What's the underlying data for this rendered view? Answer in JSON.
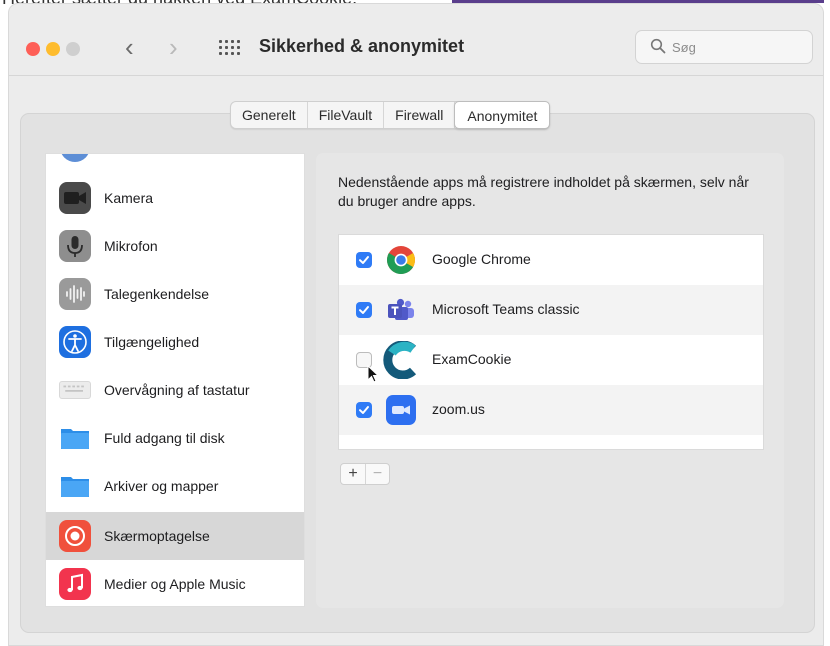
{
  "caption": "Herefter sætter du hakken ved ExamCookie.",
  "window": {
    "title": "Sikkerhed & anonymitet",
    "search_placeholder": "Søg"
  },
  "tabs": [
    {
      "label": "Generelt",
      "active": false
    },
    {
      "label": "FileVault",
      "active": false
    },
    {
      "label": "Firewall",
      "active": false
    },
    {
      "label": "Anonymitet",
      "active": true
    }
  ],
  "sidebar": {
    "items": [
      {
        "label": "Kamera",
        "icon": "camera-icon"
      },
      {
        "label": "Mikrofon",
        "icon": "microphone-icon"
      },
      {
        "label": "Talegenkendelse",
        "icon": "speech-recognition-icon"
      },
      {
        "label": "Tilgængelighed",
        "icon": "accessibility-icon"
      },
      {
        "label": "Overvågning af tastatur",
        "icon": "keyboard-icon"
      },
      {
        "label": "Fuld adgang til disk",
        "icon": "folder-icon"
      },
      {
        "label": "Arkiver og mapper",
        "icon": "folder-icon"
      },
      {
        "label": "Skærmoptagelse",
        "icon": "screen-recording-icon",
        "selected": true
      },
      {
        "label": "Medier og Apple Music",
        "icon": "music-icon"
      }
    ]
  },
  "panel": {
    "description": "Nedenstående apps må registrere indholdet på skærmen, selv når du bruger andre apps.",
    "apps": [
      {
        "name": "Google Chrome",
        "checked": true,
        "icon": "chrome-icon"
      },
      {
        "name": "Microsoft Teams classic",
        "checked": true,
        "icon": "teams-icon"
      },
      {
        "name": "ExamCookie",
        "checked": false,
        "icon": "examcookie-icon"
      },
      {
        "name": "zoom.us",
        "checked": true,
        "icon": "zoom-icon"
      }
    ],
    "add_label": "+",
    "remove_label": "−"
  },
  "colors": {
    "accent": "#2f7bf6",
    "red_light": "#fe5f57",
    "yellow_light": "#febc2e",
    "selected_row": "#d7d7d7"
  }
}
